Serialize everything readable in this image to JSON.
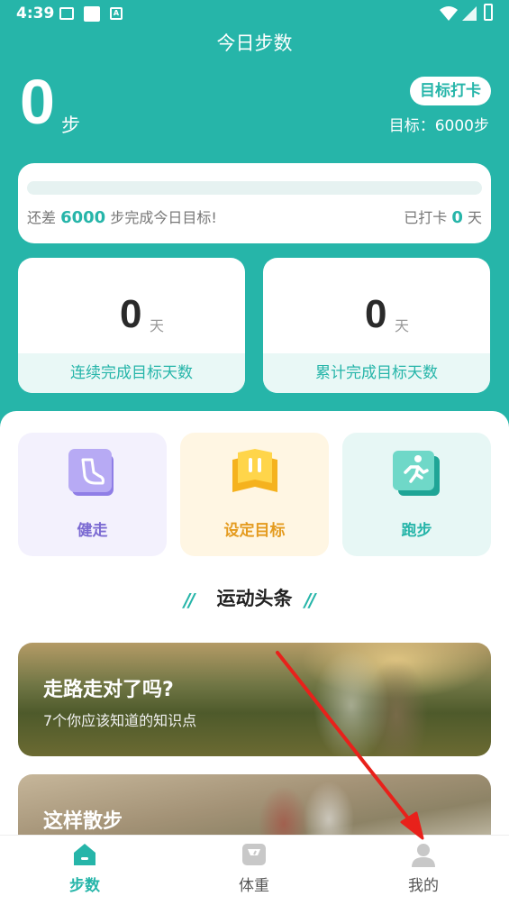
{
  "status_bar": {
    "time": "4:39"
  },
  "header": {
    "title": "今日步数",
    "steps_value": "0",
    "steps_unit": "步",
    "checkin_button": "目标打卡",
    "goal_label": "目标：6000步"
  },
  "progress": {
    "percent": 0,
    "remain_prefix": "还差",
    "remain_value": "6000",
    "remain_suffix": "步完成今日目标!",
    "punched_prefix": "已打卡",
    "punched_value": "0",
    "punched_suffix": "天"
  },
  "stats": [
    {
      "value": "0",
      "unit": "天",
      "label": "连续完成目标天数"
    },
    {
      "value": "0",
      "unit": "天",
      "label": "累计完成目标天数"
    }
  ],
  "features": [
    {
      "label": "健走",
      "icon": "shoe-icon",
      "color": "#7b6ad2"
    },
    {
      "label": "设定目标",
      "icon": "target-book-icon",
      "color": "#e49b1f"
    },
    {
      "label": "跑步",
      "icon": "runner-icon",
      "color": "#26b5a9"
    }
  ],
  "news": {
    "heading": "运动头条",
    "articles": [
      {
        "title": "走路走对了吗?",
        "subtitle": "7个你应该知道的知识点"
      },
      {
        "title": "这样散步"
      }
    ]
  },
  "bottom_nav": [
    {
      "label": "步数",
      "icon": "home-icon",
      "active": true
    },
    {
      "label": "体重",
      "icon": "scale-icon",
      "active": false
    },
    {
      "label": "我的",
      "icon": "person-icon",
      "active": false
    }
  ],
  "colors": {
    "accent": "#26b5a9",
    "annotation_arrow": "#e8211b"
  }
}
